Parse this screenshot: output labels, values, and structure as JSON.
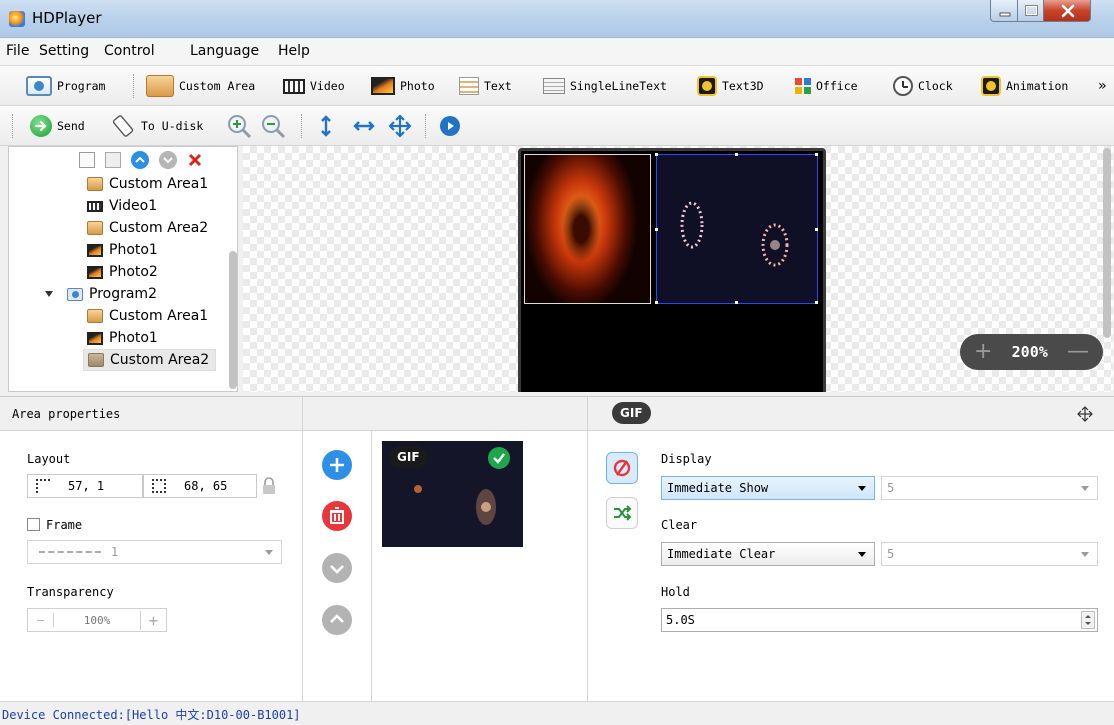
{
  "window": {
    "title": "HDPlayer"
  },
  "menu": [
    "File",
    "Setting",
    "Control",
    "Language",
    "Help"
  ],
  "toolbar1": {
    "program": "Program",
    "custom_area": "Custom Area",
    "video": "Video",
    "photo": "Photo",
    "text": "Text",
    "single_line_text": "SingleLineText",
    "text3d": "Text3D",
    "office": "Office",
    "clock": "Clock",
    "animation": "Animation",
    "more": "»"
  },
  "toolbar2": {
    "send": "Send",
    "to_udisk": "To U-disk"
  },
  "tree": {
    "items": [
      "Custom Area1",
      "Video1",
      "Custom Area2",
      "Photo1",
      "Photo2",
      "Program2",
      "Custom Area1",
      "Photo1",
      "Custom Area2"
    ]
  },
  "canvas": {
    "zoom": "200%",
    "zoom_in": "+",
    "zoom_out": "—"
  },
  "properties": {
    "title": "Area properties",
    "layout_label": "Layout",
    "position": "57, 1",
    "size": "68, 65",
    "frame_label": "Frame",
    "frame_value": "1",
    "transparency_label": "Transparency",
    "transparency_value": "100%",
    "minus": "—",
    "plus": "+"
  },
  "media": {
    "badge": "GIF",
    "thumb_badge": "GIF"
  },
  "effects": {
    "display_label": "Display",
    "display_value": "Immediate Show",
    "display_speed": "5",
    "clear_label": "Clear",
    "clear_value": "Immediate Clear",
    "clear_speed": "5",
    "hold_label": "Hold",
    "hold_value": "5.0S"
  },
  "status": {
    "text": "Device Connected:[Hello 中文:D10-00-B1001]"
  },
  "colors": {
    "accent_blue": "#2e8fe6",
    "delete_red": "#e8363b",
    "green_check": "#1ea64a",
    "status_text": "#1a3fb0"
  }
}
